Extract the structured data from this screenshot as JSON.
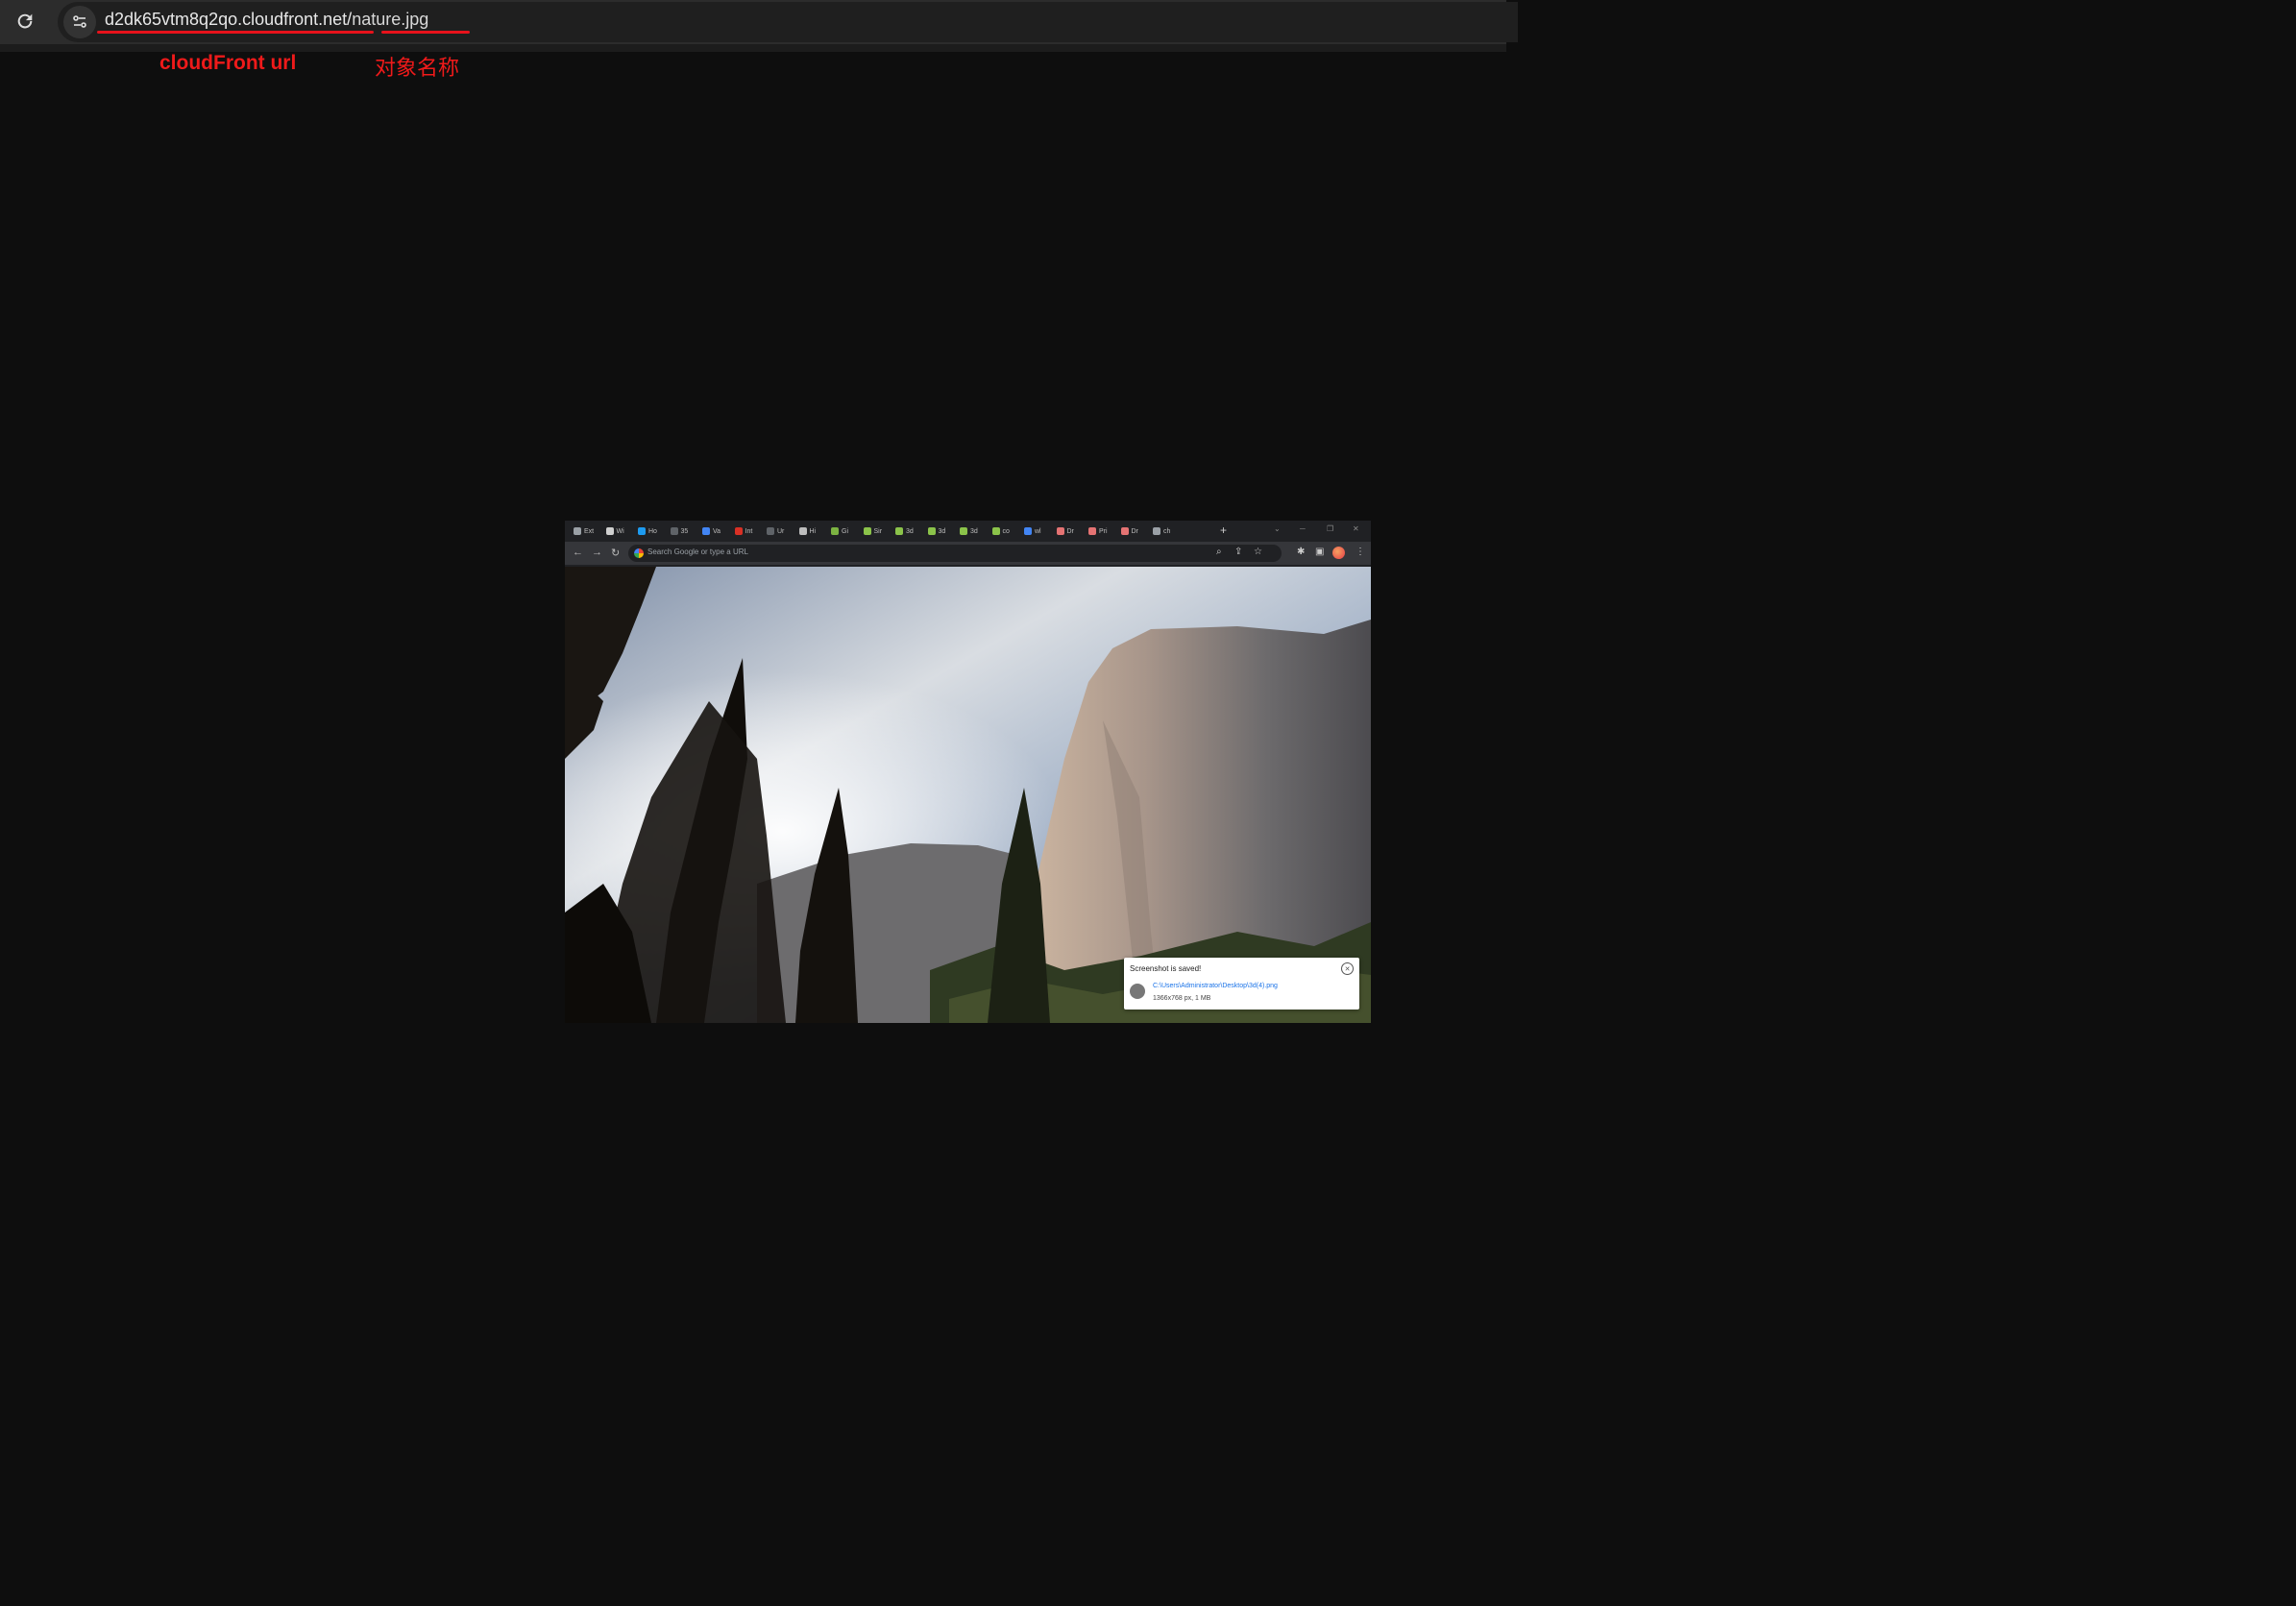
{
  "browser": {
    "url_host": "d2dk65vtm8q2qo.cloudfront.net/",
    "url_path": "nature.jpg",
    "reload_icon": "reload-icon",
    "site_info_icon": "tune-icon"
  },
  "annotations": {
    "host_label": "cloudFront url",
    "path_label": "对象名称",
    "color": "#ef1a1a"
  },
  "screenshot": {
    "tabs": [
      {
        "label": "Ext",
        "color": "#9aa0a6"
      },
      {
        "label": "Wi",
        "color": "#cfcfcf"
      },
      {
        "label": "Ho",
        "color": "#1d9bf0"
      },
      {
        "label": "35",
        "color": "#5f6368"
      },
      {
        "label": "Va",
        "color": "#4285f4"
      },
      {
        "label": "Int",
        "color": "#d93025"
      },
      {
        "label": "Ur",
        "color": "#5f6368"
      },
      {
        "label": "Hi",
        "color": "#bdbdbd"
      },
      {
        "label": "Gi",
        "color": "#7cb342"
      },
      {
        "label": "Sir",
        "color": "#8bc34a"
      },
      {
        "label": "3d",
        "color": "#8bc34a"
      },
      {
        "label": "3d",
        "color": "#8bc34a"
      },
      {
        "label": "3d",
        "color": "#8bc34a"
      },
      {
        "label": "co",
        "color": "#8bc34a"
      },
      {
        "label": "wl",
        "color": "#4285f4"
      },
      {
        "label": "Dr",
        "color": "#e57373"
      },
      {
        "label": "Pri",
        "color": "#e57373"
      },
      {
        "label": "Dr",
        "color": "#e57373"
      },
      {
        "label": "ch",
        "color": "#9aa0a6"
      }
    ],
    "omnibox_placeholder": "Search Google or type a URL",
    "toast": {
      "title": "Screenshot is saved!",
      "path": "C:\\Users\\Administrator\\Desktop\\3d(4).png",
      "info": "1366x768 px, 1 MB"
    }
  }
}
